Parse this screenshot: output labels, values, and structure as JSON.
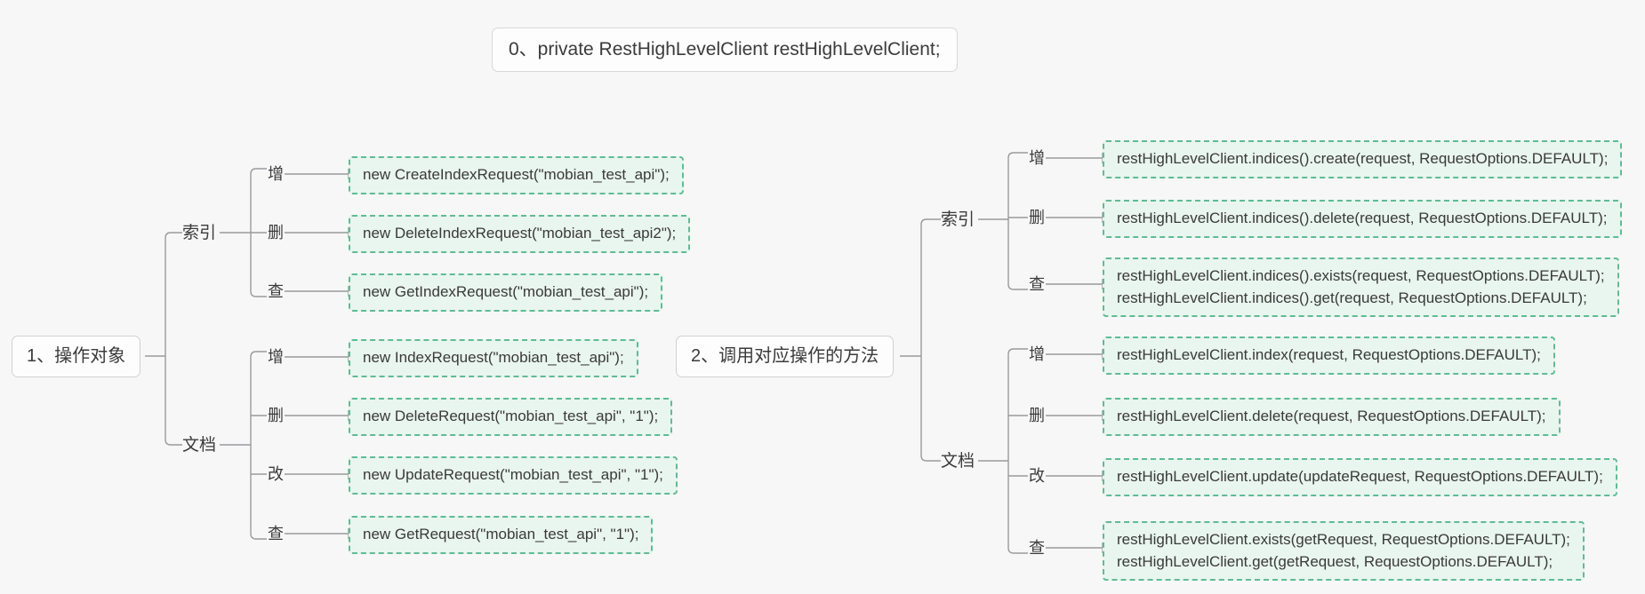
{
  "diagram": {
    "title": "0、private RestHighLevelClient restHighLevelClient;",
    "background_color": "#f7f7f7",
    "box_fill_color": "#e9f5ef",
    "box_border_color": "#60bb96",
    "connector_color": "#9a9a9e",
    "root_box_color": "#fdfdfd"
  },
  "left": {
    "root": "1、操作对象",
    "categories": [
      {
        "name": "索引",
        "items": [
          {
            "label": "增",
            "code": [
              "new CreateIndexRequest(\"mobian_test_api\");"
            ]
          },
          {
            "label": "删",
            "code": [
              "new DeleteIndexRequest(\"mobian_test_api2\");"
            ]
          },
          {
            "label": "查",
            "code": [
              "new GetIndexRequest(\"mobian_test_api\");"
            ]
          }
        ]
      },
      {
        "name": "文档",
        "items": [
          {
            "label": "增",
            "code": [
              "new IndexRequest(\"mobian_test_api\");"
            ]
          },
          {
            "label": "删",
            "code": [
              "new DeleteRequest(\"mobian_test_api\", \"1\");"
            ]
          },
          {
            "label": "改",
            "code": [
              "new UpdateRequest(\"mobian_test_api\", \"1\");"
            ]
          },
          {
            "label": "查",
            "code": [
              "new GetRequest(\"mobian_test_api\", \"1\");"
            ]
          }
        ]
      }
    ]
  },
  "right": {
    "root": "2、调用对应操作的方法",
    "categories": [
      {
        "name": "索引",
        "items": [
          {
            "label": "增",
            "code": [
              "restHighLevelClient.indices().create(request, RequestOptions.DEFAULT);"
            ]
          },
          {
            "label": "删",
            "code": [
              "restHighLevelClient.indices().delete(request, RequestOptions.DEFAULT);"
            ]
          },
          {
            "label": "查",
            "code": [
              "restHighLevelClient.indices().exists(request, RequestOptions.DEFAULT);",
              "restHighLevelClient.indices().get(request, RequestOptions.DEFAULT);"
            ]
          }
        ]
      },
      {
        "name": "文档",
        "items": [
          {
            "label": "增",
            "code": [
              "restHighLevelClient.index(request, RequestOptions.DEFAULT);"
            ]
          },
          {
            "label": "删",
            "code": [
              "restHighLevelClient.delete(request, RequestOptions.DEFAULT);"
            ]
          },
          {
            "label": "改",
            "code": [
              "restHighLevelClient.update(updateRequest, RequestOptions.DEFAULT);"
            ]
          },
          {
            "label": "查",
            "code": [
              "restHighLevelClient.exists(getRequest, RequestOptions.DEFAULT);",
              "restHighLevelClient.get(getRequest, RequestOptions.DEFAULT);"
            ]
          }
        ]
      }
    ]
  }
}
